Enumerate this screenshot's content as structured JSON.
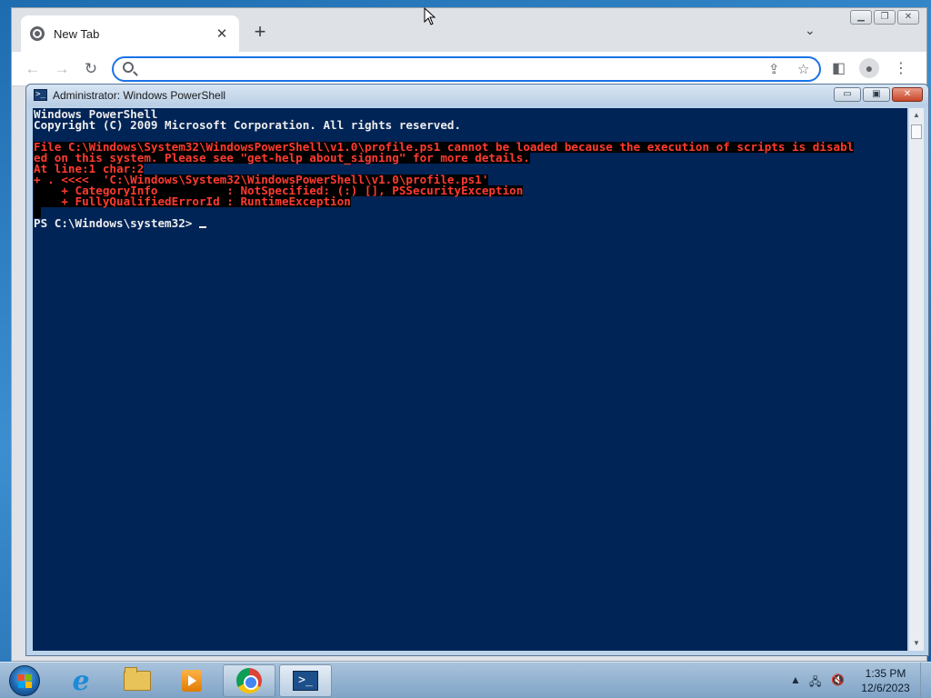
{
  "browser": {
    "tab_title": "New Tab",
    "tab_close_glyph": "✕",
    "new_tab_glyph": "+",
    "tab_search_glyph": "⌄",
    "omnibox_value": "",
    "omnibox_placeholder": "",
    "nav": {
      "back_glyph": "←",
      "forward_glyph": "→",
      "reload_glyph": "↻"
    },
    "icons": [
      "chrome-favicon",
      "search-icon",
      "share-icon",
      "star-icon",
      "side-panel-icon",
      "profile-icon",
      "menu-icon"
    ]
  },
  "powershell": {
    "title": "Administrator: Windows PowerShell",
    "icon_glyph": ">_",
    "controls": {
      "minimize": "▭",
      "maximize": "▣",
      "close": "✕"
    },
    "lines": {
      "l1": "Windows PowerShell",
      "l2": "Copyright (C) 2009 Microsoft Corporation. All rights reserved.",
      "e1": "File C:\\Windows\\System32\\WindowsPowerShell\\v1.0\\profile.ps1 cannot be loaded because the execution of scripts is disabl",
      "e2": "ed on this system. Please see \"get-help about_signing\" for more details.",
      "e3": "At line:1 char:2",
      "e4": "+ . <<<<  'C:\\Windows\\System32\\WindowsPowerShell\\v1.0\\profile.ps1'",
      "e5": "    + CategoryInfo          : NotSpecified: (:) [], PSSecurityException",
      "e6": "    + FullyQualifiedErrorId : RuntimeException",
      "prompt": "PS C:\\Windows\\system32> "
    },
    "colors": {
      "background": "#012456",
      "text": "#EDEDED",
      "error_text": "#FF3B30",
      "error_background": "#000000"
    }
  },
  "taskbar": {
    "items": [
      "start-button",
      "internet-explorer",
      "windows-explorer",
      "windows-media-player",
      "google-chrome",
      "windows-powershell"
    ],
    "clock": {
      "time": "1:35 PM",
      "date": "12/6/2023"
    },
    "tray_icons": [
      "show-hidden-icons",
      "network-icon",
      "volume-muted-icon"
    ]
  }
}
